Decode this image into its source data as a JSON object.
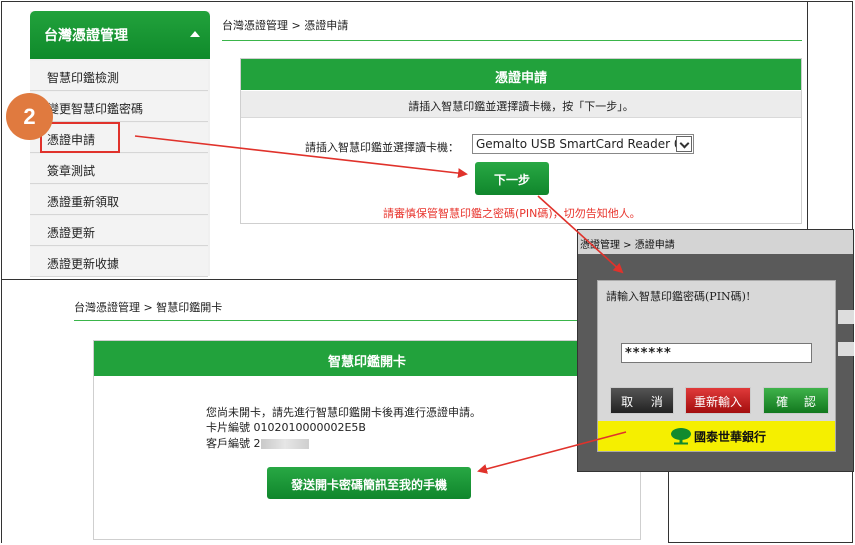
{
  "sidebar": {
    "header": "台灣憑證管理",
    "items": [
      "智慧印鑑檢測",
      "變更智慧印鑑密碼",
      "憑證申請",
      "簽章測試",
      "憑證重新領取",
      "憑證更新",
      "憑證更新收據"
    ]
  },
  "top": {
    "breadcrumb": "台灣憑證管理 > 憑證申請",
    "form_title": "憑證申請",
    "instruction": "請插入智慧印鑑並選擇讀卡機，按「下一步」。",
    "reader_label": "請插入智慧印鑑並選擇讀卡機：",
    "reader_value": "Gemalto USB SmartCard Reader 0",
    "next_button": "下一步",
    "warning": "請審慎保管智慧印鑑之密碼(PIN碼)，切勿告知他人。"
  },
  "bottom": {
    "breadcrumb": "台灣憑證管理 > 智慧印鑑開卡",
    "title": "智慧印鑑開卡",
    "message": "您尚未開卡，請先進行智慧印鑑開卡後再進行憑證申請。",
    "card_no": "卡片編號 0102010000002E5B",
    "customer_no": "客戶編號 2",
    "sms_button": "發送開卡密碼簡訊至我的手機"
  },
  "pin_dialog": {
    "header": "憑證管理 > 憑證申請",
    "prompt": "請輸入智慧印鑑密碼(PIN碼)!",
    "pin_value": "******",
    "cancel": "取 消",
    "reenter": "重新輸入",
    "confirm": "確 認",
    "bank_name": "國泰世華銀行"
  },
  "annotation": {
    "step_number": "2",
    "accent_color": "#e07a3f",
    "arrow_color": "#e0322b"
  }
}
